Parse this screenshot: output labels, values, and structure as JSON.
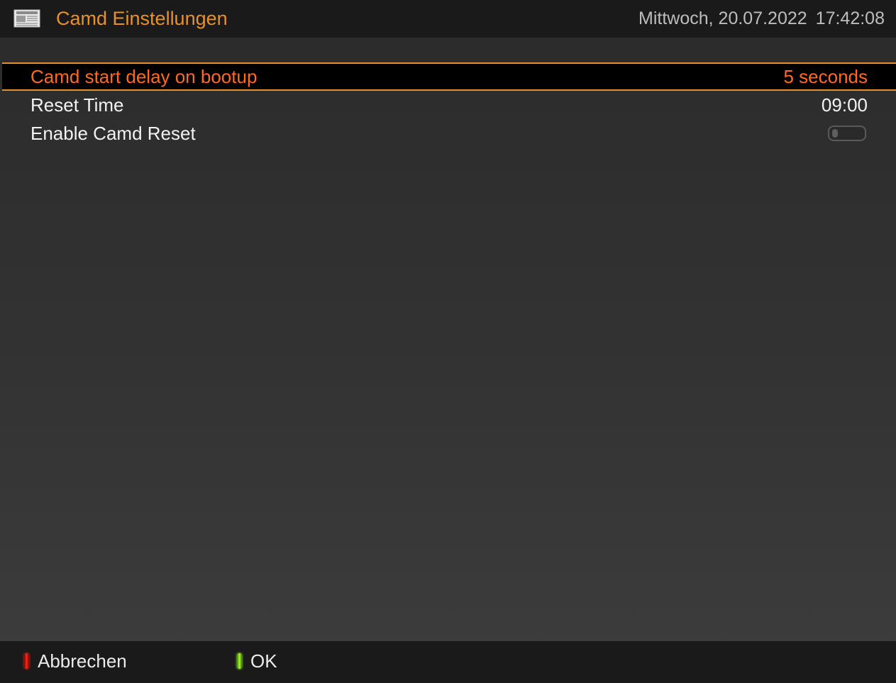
{
  "header": {
    "title": "Camd Einstellungen",
    "date": "Mittwoch, 20.07.2022",
    "time": "17:42:08",
    "icon": "newspaper-icon"
  },
  "settings": [
    {
      "label": "Camd start delay on bootup",
      "value": "5 seconds",
      "selected": true
    },
    {
      "label": "Reset Time",
      "value": "09:00",
      "selected": false
    },
    {
      "label": "Enable Camd Reset",
      "value": null,
      "control": "toggle",
      "toggle_on": false,
      "selected": false
    }
  ],
  "footer": {
    "buttons": [
      {
        "color": "red",
        "label": "Abbrechen"
      },
      {
        "color": "green",
        "label": "OK"
      }
    ]
  },
  "colors": {
    "accent": "#e8902a",
    "selected_text": "#ff6a1f",
    "header_bg": "#1a1a1a"
  }
}
